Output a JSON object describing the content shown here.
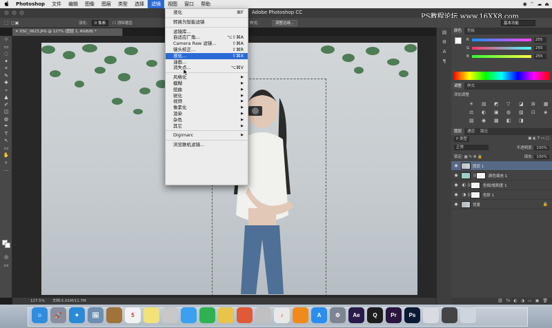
{
  "menubar": {
    "apple": "",
    "items": [
      "Photoshop",
      "文件",
      "编辑",
      "图像",
      "图层",
      "类型",
      "选择",
      "滤镜",
      "视图",
      "窗口",
      "帮助"
    ],
    "active_index": 7,
    "status": [
      "◉",
      "⌔",
      "☁",
      "⏏"
    ]
  },
  "window": {
    "title": "Adobe Photoshop CC",
    "watermark": "PS教程论坛 www.16XX8.com"
  },
  "options_bar": {
    "feather_label": "羽化:",
    "feather_value": "0 像素",
    "antialias": "消除锯齿",
    "style_label": "样式:",
    "refine_button": "调整边缘...",
    "workspace": "基本功能"
  },
  "document": {
    "tab": "DSC_0623.JPG @ 127% (图层 1, RGB/8) *",
    "zoom": "127.5%",
    "doc_size": "文档:5.01M/11.7M"
  },
  "filter_menu": {
    "items": [
      {
        "label": "液化",
        "shortcut": "⌘F"
      },
      {
        "sep": true
      },
      {
        "label": "转换为智能滤镜",
        "shortcut": ""
      },
      {
        "sep": true
      },
      {
        "label": "滤镜库...",
        "shortcut": ""
      },
      {
        "label": "自适应广角...",
        "shortcut": "⌥⇧⌘A"
      },
      {
        "label": "Camera Raw 滤镜...",
        "shortcut": "⇧⌘A"
      },
      {
        "label": "镜头校正...",
        "shortcut": "⇧⌘R"
      },
      {
        "label": "液化...",
        "shortcut": "⇧⌘X",
        "highlight": true
      },
      {
        "label": "油画...",
        "shortcut": ""
      },
      {
        "label": "消失点...",
        "shortcut": "⌥⌘V"
      },
      {
        "sep": true
      },
      {
        "label": "风格化",
        "submenu": true
      },
      {
        "label": "模糊",
        "submenu": true
      },
      {
        "label": "扭曲",
        "submenu": true
      },
      {
        "label": "锐化",
        "submenu": true
      },
      {
        "label": "视频",
        "submenu": true
      },
      {
        "label": "像素化",
        "submenu": true
      },
      {
        "label": "渲染",
        "submenu": true
      },
      {
        "label": "杂色",
        "submenu": true
      },
      {
        "label": "其它",
        "submenu": true
      },
      {
        "sep": true
      },
      {
        "label": "Digimarc",
        "submenu": true
      },
      {
        "sep": true
      },
      {
        "label": "浏览联机滤镜...",
        "shortcut": ""
      }
    ]
  },
  "color_panel": {
    "tabs": [
      "颜色",
      "色板"
    ],
    "channels": [
      {
        "label": "R",
        "value": "255",
        "color": "#d040d0"
      },
      {
        "label": "G",
        "value": "255",
        "color": "#40c0d0"
      },
      {
        "label": "B",
        "value": "255",
        "color": "#d0d040"
      }
    ]
  },
  "adjustments_panel": {
    "tabs": [
      "调整",
      "样式"
    ],
    "title": "添加调整",
    "icons": [
      "☀",
      "▤",
      "◩",
      "▽",
      "◪",
      "⊞",
      "▦",
      "⚖",
      "◐",
      "▣",
      "◍",
      "▧",
      "⊡",
      "◈",
      "▨",
      "◉",
      "▩",
      "◧",
      "◨"
    ]
  },
  "layers_panel": {
    "tabs": [
      "图层",
      "通道",
      "路径"
    ],
    "kind": "P 类型",
    "blend": "正常",
    "opacity_label": "不透明度:",
    "opacity": "100%",
    "lock_label": "锁定:",
    "fill_label": "填充:",
    "fill": "100%",
    "layers": [
      {
        "name": "图层 1",
        "selected": true,
        "type": "photo"
      },
      {
        "name": "颜色填充 1",
        "type": "fill",
        "thumb": "#9fd0c8"
      },
      {
        "name": "色相/饱和度 1",
        "type": "adjust"
      },
      {
        "name": "色阶 1",
        "type": "adjust"
      },
      {
        "name": "背景",
        "type": "photo",
        "locked": true
      }
    ],
    "bottom_icons": [
      "⛓",
      "fx",
      "◐",
      "◑",
      "▭",
      "▣",
      "🗑"
    ]
  },
  "toolbox": {
    "icons": [
      "⊹",
      "▭",
      "◌",
      "✦",
      "⌗",
      "✎",
      "✚",
      "⌁",
      "▲",
      "✐",
      "◫",
      "◍",
      "✒",
      "T",
      "↖",
      "▭",
      "✋",
      "⌕",
      "…"
    ]
  },
  "dock": {
    "icons": [
      {
        "name": "finder",
        "label": "☺",
        "color": "#2f8de0"
      },
      {
        "name": "launchpad",
        "label": "🚀",
        "color": "#8a8fa0"
      },
      {
        "name": "safari",
        "label": "✦",
        "color": "#2a8ad8"
      },
      {
        "name": "preview",
        "label": "🖼",
        "color": "#6d8fb0"
      },
      {
        "name": "notes-book",
        "label": "",
        "color": "#a0733a"
      },
      {
        "name": "calendar",
        "label": "5",
        "color": "#f2f2f2"
      },
      {
        "name": "stickies",
        "label": "",
        "color": "#f2e27a"
      },
      {
        "name": "photos-preview",
        "label": "",
        "color": "#c8c8c8"
      },
      {
        "name": "messages",
        "label": "",
        "color": "#3aa0f0"
      },
      {
        "name": "facetime",
        "label": "",
        "color": "#2fb24f"
      },
      {
        "name": "photos",
        "label": "",
        "color": "#e8c44a"
      },
      {
        "name": "numbers-chart",
        "label": "",
        "color": "#e05a3a"
      },
      {
        "name": "photo-booth",
        "label": "",
        "color": "#c0c0c0"
      },
      {
        "name": "itunes",
        "label": "♪",
        "color": "#e8e8e8"
      },
      {
        "name": "ibooks",
        "label": "",
        "color": "#f08a1a"
      },
      {
        "name": "app-store",
        "label": "A",
        "color": "#2a8ef0"
      },
      {
        "name": "system-preferences",
        "label": "⚙",
        "color": "#7d8690"
      },
      {
        "name": "after-effects",
        "label": "Ae",
        "color": "#2a1a4a"
      },
      {
        "name": "quicktime",
        "label": "Q",
        "color": "#1d1d1d"
      },
      {
        "name": "premiere",
        "label": "Pr",
        "color": "#2a1440"
      },
      {
        "name": "photoshop",
        "label": "Ps",
        "color": "#0a1a34"
      },
      {
        "name": "downloads",
        "label": "",
        "color": "#d8dbe0"
      },
      {
        "name": "screen-clip",
        "label": "",
        "color": "#444"
      },
      {
        "name": "trash",
        "label": "",
        "color": "#cfd5dc"
      }
    ]
  }
}
